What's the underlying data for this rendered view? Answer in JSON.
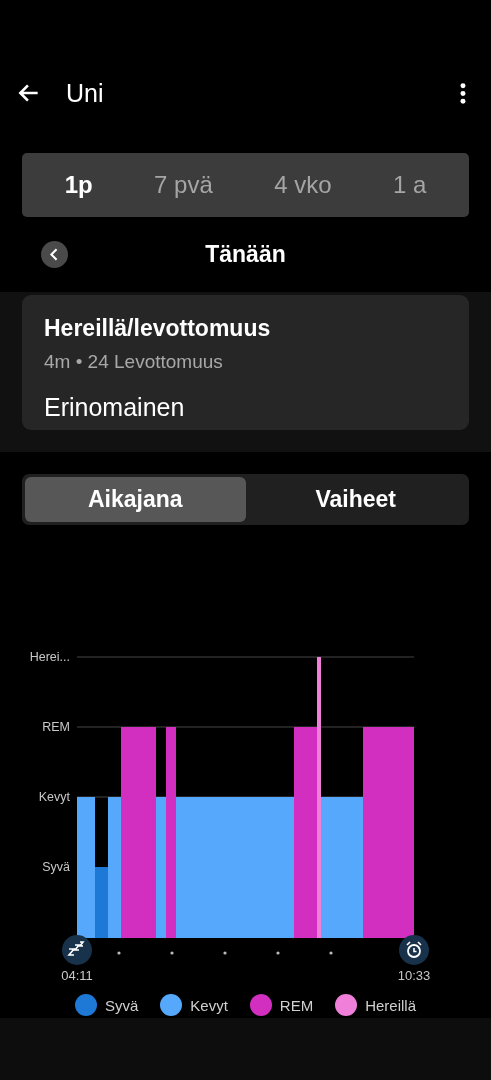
{
  "header": {
    "title": "Uni"
  },
  "periods": [
    {
      "label": "1p",
      "selected": true
    },
    {
      "label": "7 pvä",
      "selected": false
    },
    {
      "label": "4 vko",
      "selected": false
    },
    {
      "label": "1 a",
      "selected": false
    }
  ],
  "date_nav": {
    "title": "Tänään"
  },
  "card": {
    "title": "Hereillä/levottomuus",
    "subtitle": "4m • 24 Levottomuus",
    "rating": "Erinomainen"
  },
  "views": [
    {
      "label": "Aikajana",
      "selected": true
    },
    {
      "label": "Vaiheet",
      "selected": false
    }
  ],
  "chart": {
    "y_labels": [
      "Herei...",
      "REM",
      "Kevyt",
      "Syvä"
    ],
    "start_time": "04:11",
    "end_time": "10:33"
  },
  "legend": [
    {
      "label": "Syvä",
      "color": "#1e78d6"
    },
    {
      "label": "Kevyt",
      "color": "#55a8fb"
    },
    {
      "label": "REM",
      "color": "#d22ec0"
    },
    {
      "label": "Hereillä",
      "color": "#ef7fd9"
    }
  ]
}
